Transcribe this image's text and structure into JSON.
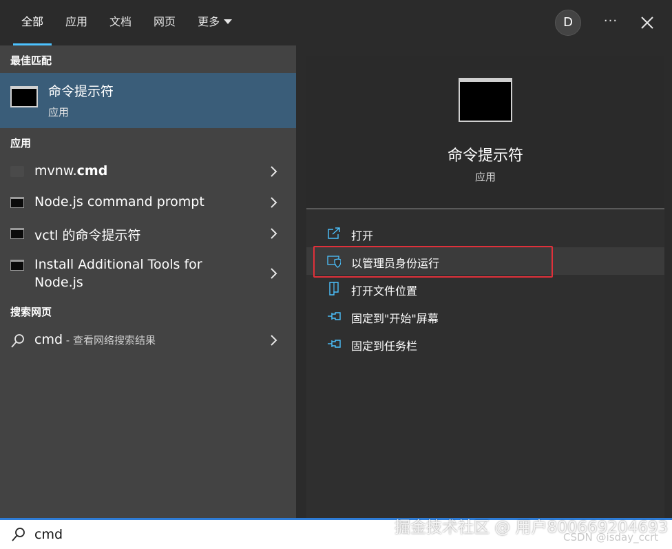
{
  "tabs": [
    {
      "label": "全部",
      "active": true
    },
    {
      "label": "应用"
    },
    {
      "label": "文档"
    },
    {
      "label": "网页"
    },
    {
      "label": "更多"
    }
  ],
  "header": {
    "avatar_letter": "D",
    "more_label": "···"
  },
  "left": {
    "best_match_title": "最佳匹配",
    "best_match": {
      "name": "命令提示符",
      "type": "应用"
    },
    "apps_title": "应用",
    "apps": [
      {
        "name_plain": "mvnw.",
        "name_bold": "cmd"
      },
      {
        "name": "Node.js command prompt"
      },
      {
        "name": "vctl 的命令提示符"
      },
      {
        "name_line1": "Install Additional Tools for",
        "name_line2": "Node.js"
      }
    ],
    "web_title": "搜索网页",
    "web": {
      "query": "cmd",
      "suffix": " - 查看网络搜索结果"
    }
  },
  "right": {
    "name": "命令提示符",
    "type": "应用",
    "actions": [
      {
        "label": "打开",
        "icon": "open-icon"
      },
      {
        "label": "以管理员身份运行",
        "icon": "shield-icon"
      },
      {
        "label": "打开文件位置",
        "icon": "file-location-icon"
      },
      {
        "label": "固定到\"开始\"屏幕",
        "icon": "pin-icon"
      },
      {
        "label": "固定到任务栏",
        "icon": "pin-icon"
      }
    ]
  },
  "search": {
    "value": "cmd"
  },
  "watermark": {
    "line1": "掘金技术社区 @ 用户800669204693",
    "line2": "CSDN @isday_ccrt"
  },
  "colors": {
    "accent": "#4cc2ff",
    "selection": "#3a5d79",
    "highlight_box": "#e0303a",
    "search_border": "#2e7cd6"
  }
}
